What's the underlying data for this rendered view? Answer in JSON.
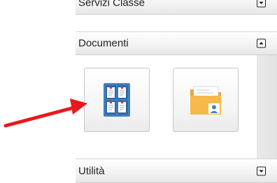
{
  "sections": [
    {
      "title": "Servizi Classe",
      "state": "collapsed",
      "toggle_icon": "expand-down-icon"
    },
    {
      "title": "Documenti",
      "state": "expanded",
      "toggle_icon": "collapse-up-icon"
    },
    {
      "title": "Utilità",
      "state": "collapsed",
      "toggle_icon": "expand-down-icon"
    }
  ],
  "documenti_tiles": [
    {
      "icon": "document-board-icon",
      "accent": "#3f7fbf"
    },
    {
      "icon": "folder-user-icon",
      "accent": "#f7b84c"
    }
  ],
  "annotation": {
    "icon": "red-arrow-icon",
    "color": "#e8191c"
  }
}
